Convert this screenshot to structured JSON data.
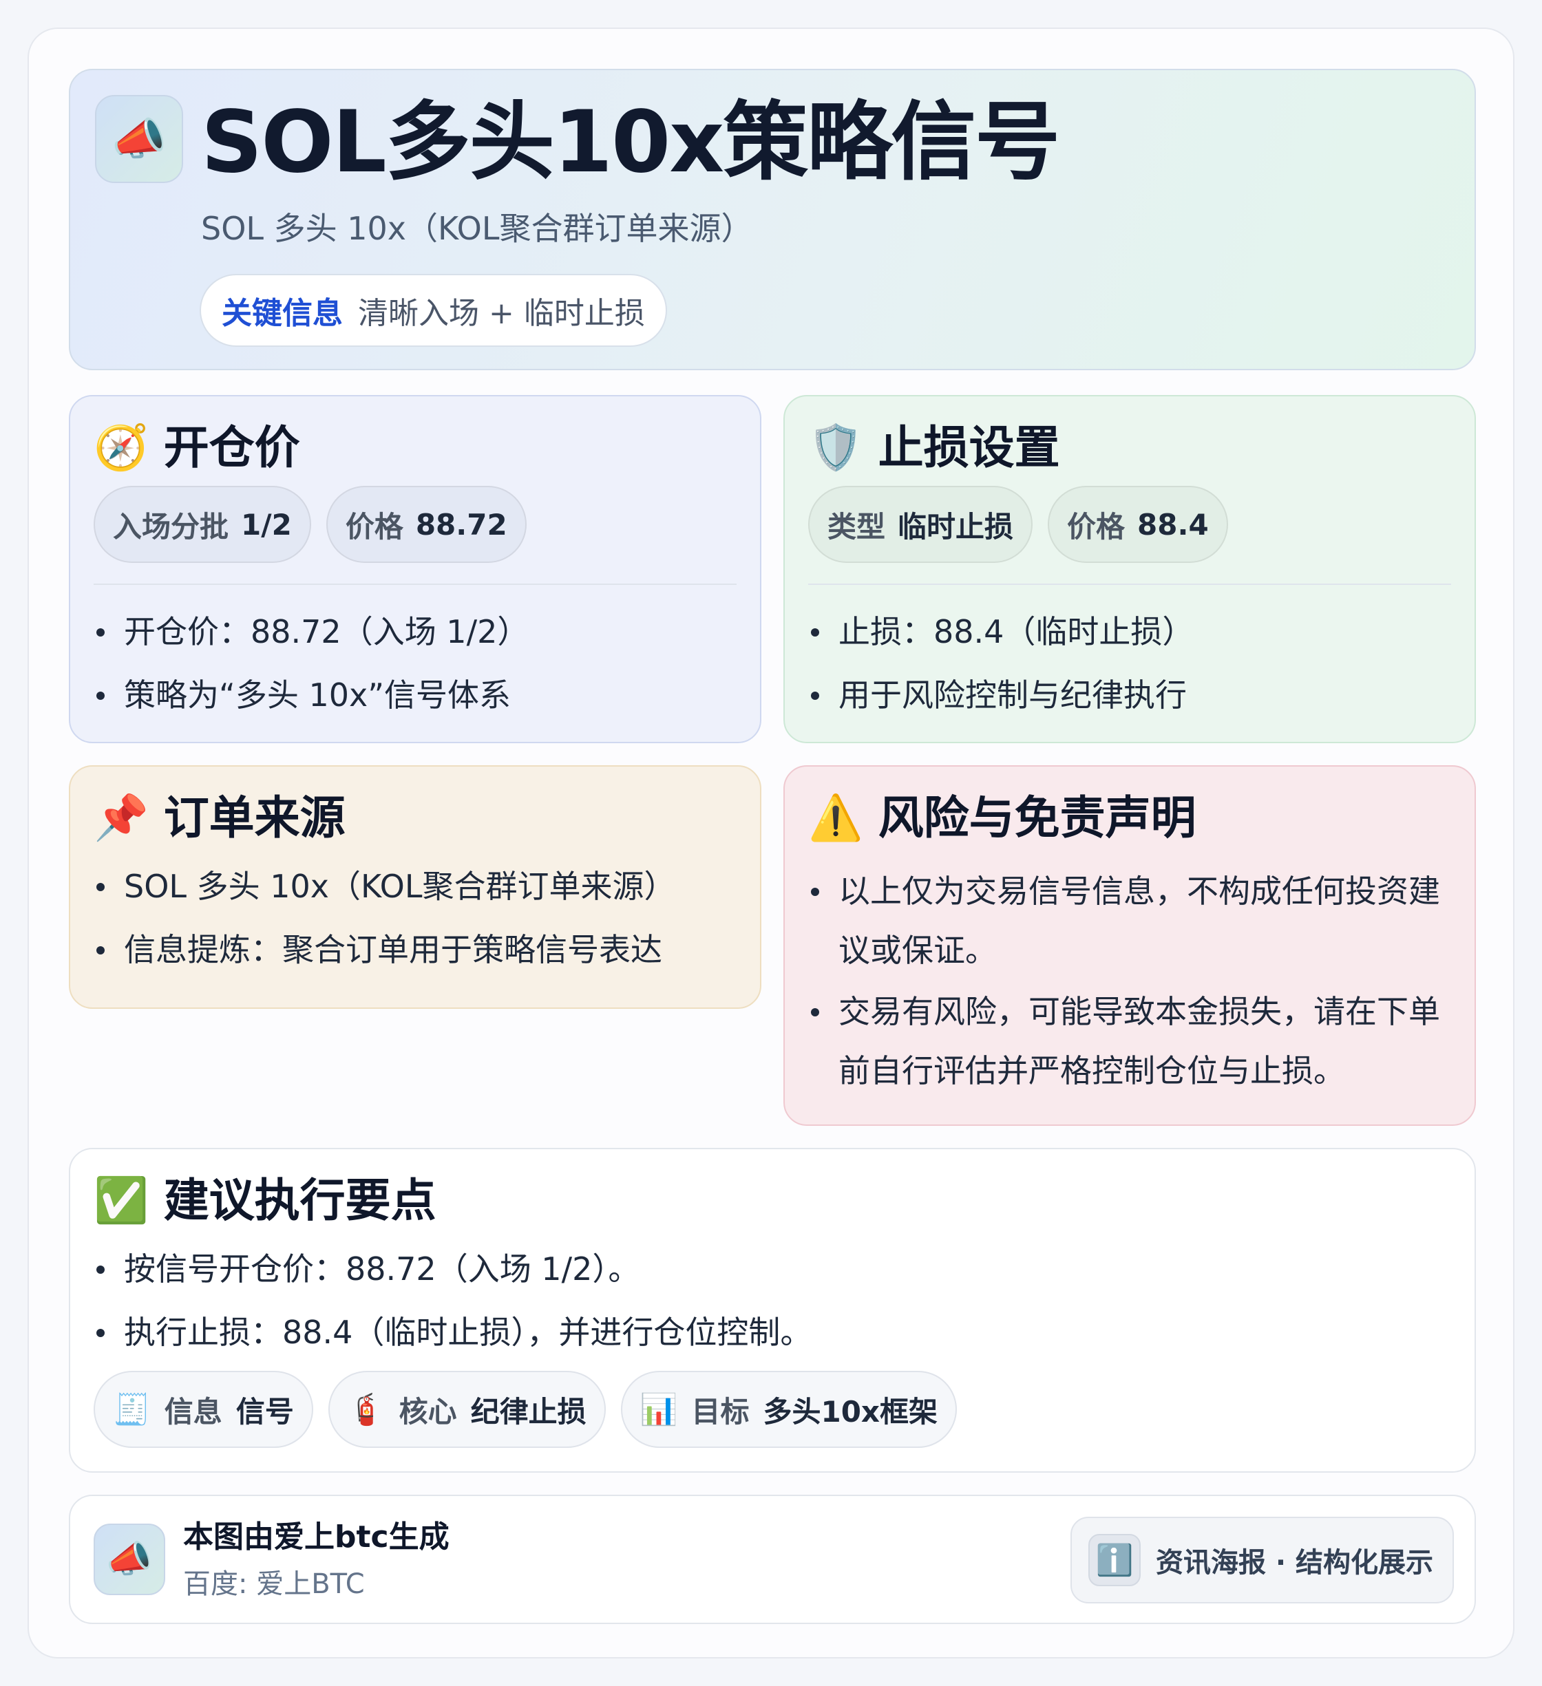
{
  "header": {
    "icon": "megaphone-icon",
    "title": "SOL多头10x策略信号",
    "subtitle": "SOL 多头 10x（KOL聚合群订单来源）",
    "pill": {
      "key": "关键信息",
      "value": "清晰入场 + 临时止损"
    }
  },
  "open_card": {
    "icon": "compass-icon",
    "title": "开仓价",
    "pills": [
      {
        "key": "入场分批",
        "value": "1/2"
      },
      {
        "key": "价格",
        "value": "88.72"
      }
    ],
    "bullets": [
      "开仓价：88.72（入场 1/2）",
      "策略为“多头 10x”信号体系"
    ]
  },
  "stop_card": {
    "icon": "shield-icon",
    "title": "止损设置",
    "pills": [
      {
        "key": "类型",
        "value": "临时止损"
      },
      {
        "key": "价格",
        "value": "88.4"
      }
    ],
    "bullets": [
      "止损：88.4（临时止损）",
      "用于风险控制与纪律执行"
    ]
  },
  "source_card": {
    "icon": "pushpin-icon",
    "title": "订单来源",
    "bullets": [
      "SOL 多头 10x（KOL聚合群订单来源）",
      "信息提炼：聚合订单用于策略信号表达"
    ]
  },
  "risk_card": {
    "icon": "warning-icon",
    "title": "风险与免责声明",
    "bullets": [
      "以上仅为交易信号信息，不构成任何投资建议或保证。",
      "交易有风险，可能导致本金损失，请在下单前自行评估并严格控制仓位与止损。"
    ]
  },
  "exec_card": {
    "icon": "check-mark-icon",
    "title": "建议执行要点",
    "bullets": [
      "按信号开仓价：88.72（入场 1/2）。",
      "执行止损：88.4（临时止损），并进行仓位控制。"
    ],
    "tags": [
      {
        "icon": "receipt-icon",
        "key": "信息",
        "value": "信号"
      },
      {
        "icon": "fire-extinguisher-icon",
        "key": "核心",
        "value": "纪律止损"
      },
      {
        "icon": "bar-chart-icon",
        "key": "目标",
        "value": "多头10x框架"
      }
    ]
  },
  "footer": {
    "icon": "megaphone-icon",
    "title": "本图由爱上btc生成",
    "subtitle": "百度: 爱上BTC",
    "badge_icon": "info-icon",
    "badge": "资讯海报 · 结构化展示"
  },
  "colors": {
    "accent_blue": "#1f4fd4",
    "open_bg": "#eef1fb",
    "stop_bg": "#ebf6ef",
    "source_bg": "#f8f1e6",
    "risk_bg": "#f9eaed"
  }
}
